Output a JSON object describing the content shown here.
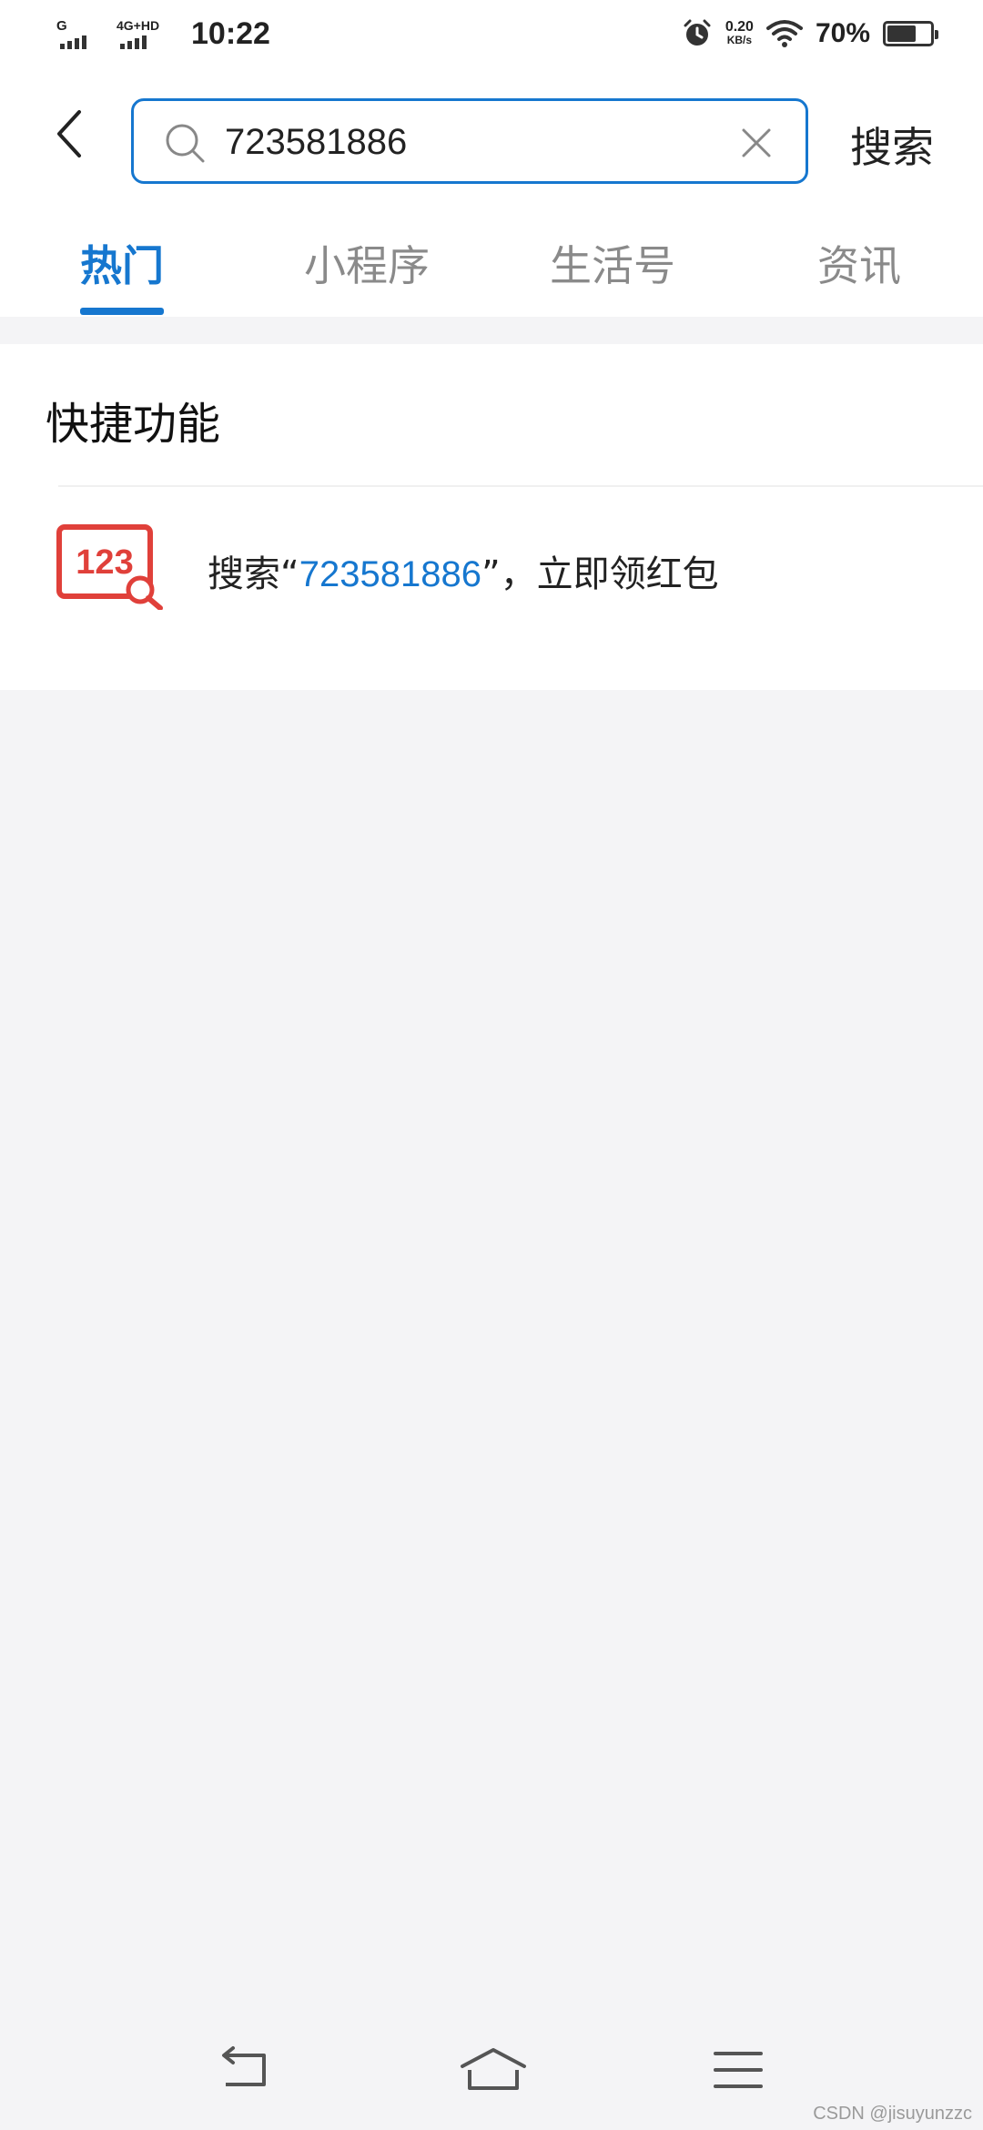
{
  "status_bar": {
    "signal1_label": "G",
    "signal2_label": "4G+HD",
    "time": "10:22",
    "net_speed_value": "0.20",
    "net_speed_unit": "KB/s",
    "battery_percent": "70%",
    "battery_level": 0.7
  },
  "search": {
    "query": "723581886",
    "submit_label": "搜索"
  },
  "tabs": [
    {
      "label": "热门",
      "active": true
    },
    {
      "label": "小程序",
      "active": false
    },
    {
      "label": "生活号",
      "active": false
    },
    {
      "label": "资讯",
      "active": false
    }
  ],
  "quick": {
    "section_title": "快捷功能",
    "icon_text": "123",
    "item_prefix": "搜索“",
    "item_number": "723581886",
    "item_suffix": "”，立即领红包"
  },
  "watermark": "CSDN @jisuyunzzc",
  "colors": {
    "accent": "#1677cf",
    "icon_red": "#e0403a",
    "background": "#f4f4f6"
  }
}
